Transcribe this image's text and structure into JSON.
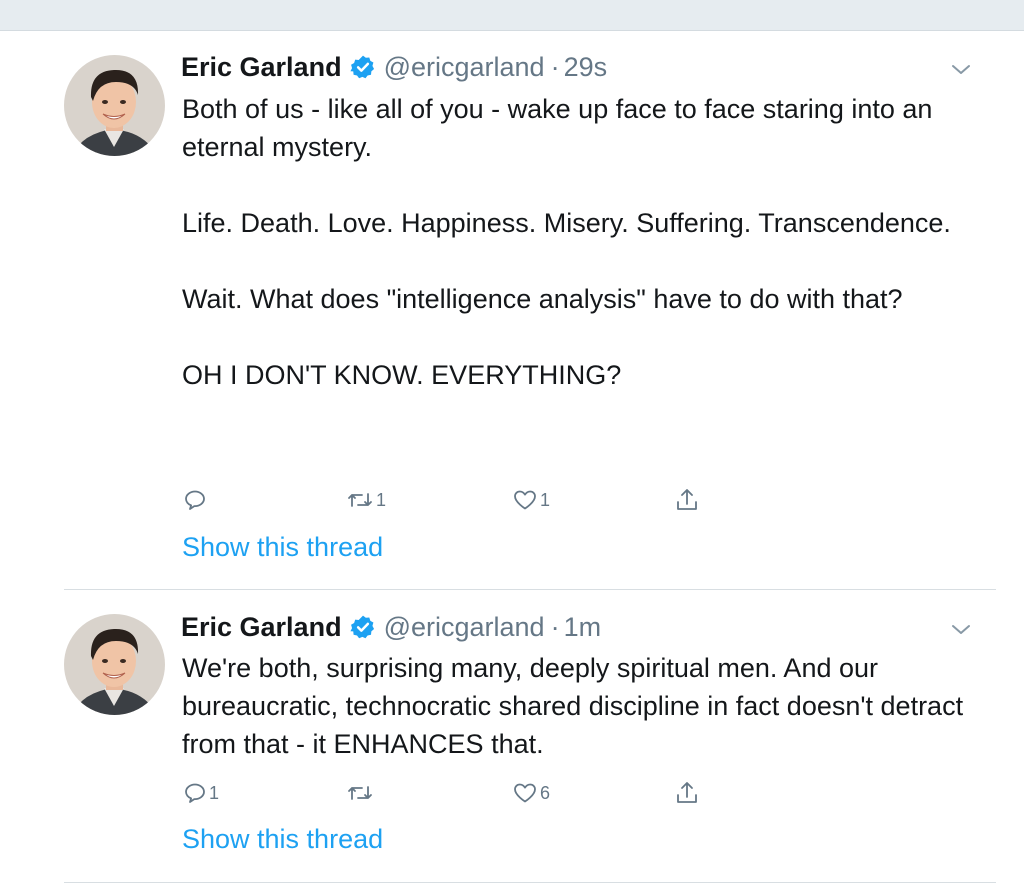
{
  "tweets": [
    {
      "author_name": "Eric Garland",
      "handle": "@ericgarland",
      "separator": "·",
      "time": "29s",
      "paragraphs": [
        "Both of us - like all of you - wake up face to face staring into an eternal mystery.",
        "Life. Death. Love. Happiness. Misery. Suffering. Transcendence.",
        "Wait. What does \"intelligence analysis\" have to do with that?",
        "OH I DON'T KNOW. EVERYTHING?"
      ],
      "reply_count": "",
      "retweet_count": "1",
      "like_count": "1",
      "show_thread": "Show this thread"
    },
    {
      "author_name": "Eric Garland",
      "handle": "@ericgarland",
      "separator": "·",
      "time": "1m",
      "paragraphs": [
        "We're both, surprising many, deeply spiritual men. And our bureaucratic, technocratic shared discipline in fact doesn't detract from that - it ENHANCES that."
      ],
      "reply_count": "1",
      "retweet_count": "",
      "like_count": "6",
      "show_thread": "Show this thread"
    }
  ],
  "icons": {
    "verified": "verified-badge-icon",
    "menu": "chevron-down-icon",
    "reply": "reply-icon",
    "retweet": "retweet-icon",
    "like": "heart-icon",
    "share": "share-icon"
  },
  "colors": {
    "link": "#1da1f2",
    "secondary": "#657786",
    "text": "#14171a",
    "verified": "#1da1f2"
  }
}
